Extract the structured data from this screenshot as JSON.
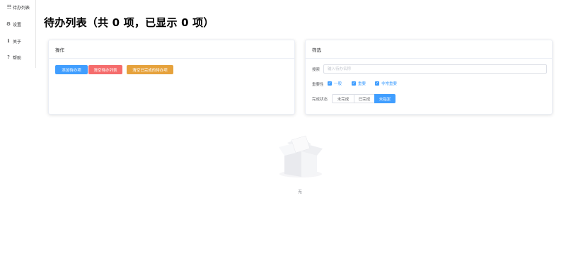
{
  "sidebar": {
    "items": [
      {
        "icon": "list-icon",
        "glyph": "☷",
        "label": "待办列表"
      },
      {
        "icon": "gear-icon",
        "glyph": "⚙",
        "label": "设置"
      },
      {
        "icon": "info-icon",
        "glyph": "ℹ",
        "label": "关于"
      },
      {
        "icon": "question-icon",
        "glyph": "?",
        "label": "帮助"
      }
    ]
  },
  "page": {
    "title": "待办列表（共 0 项，已显示 0 项）"
  },
  "operations": {
    "title": "操作",
    "add_label": "添加待办项",
    "clear_label": "清空待办列表",
    "clear_done_label": "清空已完成的待办项"
  },
  "filter": {
    "title": "筛选",
    "search_label": "搜索",
    "search_placeholder": "输入待办名称",
    "search_value": "",
    "importance_label": "重要性",
    "importance_options": [
      {
        "label": "一般",
        "checked": true
      },
      {
        "label": "重要",
        "checked": true
      },
      {
        "label": "非常重要",
        "checked": true
      }
    ],
    "status_label": "完成状态",
    "status_options": [
      "未完成",
      "已完成",
      "未指定"
    ],
    "status_selected": "未指定"
  },
  "empty": {
    "text": "无"
  },
  "colors": {
    "primary": "#409eff",
    "danger": "#f56c6c",
    "warning": "#e6a23c"
  }
}
